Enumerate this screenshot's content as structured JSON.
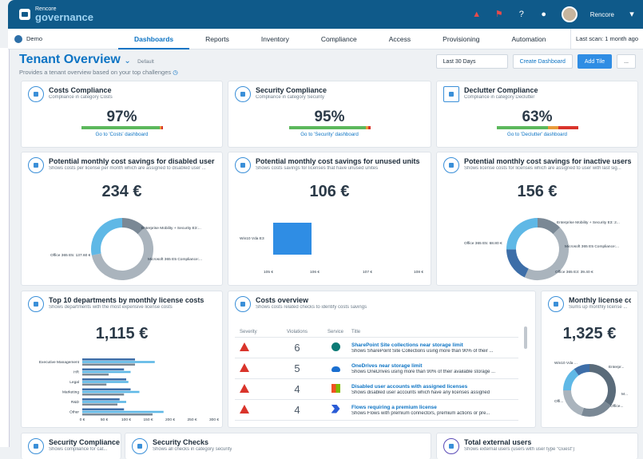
{
  "header": {
    "brand_small": "Rencore",
    "brand_big": "governance",
    "user": "Rencore"
  },
  "nav": {
    "tenant": "Demo",
    "tabs": [
      "Dashboards",
      "Reports",
      "Inventory",
      "Compliance",
      "Access",
      "Provisioning",
      "Automation"
    ],
    "last_scan": "Last scan: 1 month ago"
  },
  "page": {
    "title": "Tenant Overview",
    "default_tag": "Default",
    "subtitle": "Provides a tenant overview based on your top challenges",
    "range": "Last 30 Days",
    "create": "Create Dashboard",
    "add": "Add Tile",
    "more": "..."
  },
  "cards": {
    "costs": {
      "title": "Costs Compliance",
      "sub": "Compliance in category Costs",
      "value": "97%",
      "link": "Go to 'Costs' dashboard"
    },
    "security": {
      "title": "Security Compliance",
      "sub": "Compliance in category Security",
      "value": "95%",
      "link": "Go to 'Security' dashboard"
    },
    "declutter": {
      "title": "Declutter Compliance",
      "sub": "Compliance in category Declutter",
      "value": "63%",
      "link": "Go to 'Declutter' dashboard"
    },
    "disabled": {
      "title": "Potential monthly cost savings for disabled user acc...",
      "sub": "Shows costs per license per month which are assigned to disabled user ...",
      "value": "234 €",
      "labels": [
        "Enterprise Mobility + Security E3:...",
        "Office 365 E5: 137.60 €",
        "Microsoft 365 E5 Compliance:..."
      ]
    },
    "unused": {
      "title": "Potential monthly cost savings for unused units",
      "sub": "Shows costs savings for licenses that have unused unites",
      "value": "106 €",
      "bar_label": "Win10 Vda E3",
      "ticks": [
        "105 €",
        "106 €",
        "107 €",
        "108 €"
      ]
    },
    "inactive": {
      "title": "Potential monthly cost savings for inactive users",
      "sub": "Shows license costs for licenses which are assigned to user with last sig...",
      "value": "156 €",
      "labels": [
        "Enterprise Mobility + Security E3: 2...",
        "Office 365 E5: 68.80 €",
        "Microsoft 365 E5 Compliance:...",
        "Office 365 E3: 39.40 €"
      ]
    },
    "departments": {
      "title": "Top 10 departments by monthly license costs",
      "sub": "Shows departments with the most expensive license costs",
      "value": "1,115 €",
      "cats": [
        "Executive Management",
        "HR",
        "Legal",
        "Marketing",
        "R&D",
        "Other"
      ],
      "ticks": [
        "0 €",
        "50 €",
        "100 €",
        "150 €",
        "200 €",
        "250 €",
        "300 €"
      ]
    },
    "overview": {
      "title": "Costs overview",
      "sub": "Shows costs related checks to identify costs savings",
      "cols": [
        "Severity",
        "Violations",
        "Service",
        "Title"
      ],
      "rows": [
        {
          "violations": "6",
          "title": "SharePoint Site collections near storage limit",
          "desc": "Shows SharePoint Site Collections using more than 90% of their ..."
        },
        {
          "violations": "5",
          "title": "OneDrives near storage limit",
          "desc": "Shows OneDrives using more than 90% of their available storage ..."
        },
        {
          "violations": "4",
          "title": "Disabled user accounts with assigned licenses",
          "desc": "Shows disabled user accounts which have any licenses assigned"
        },
        {
          "violations": "4",
          "title": "Flows requiring a premium license",
          "desc": "Shows Flows with premium connectors, premium actions or pre..."
        }
      ]
    },
    "monthly": {
      "title": "Monthly license co...",
      "sub": "Sums up monthly license ...",
      "value": "1,325 €",
      "labels": [
        "Win10 Vda ...",
        "Enterpr...",
        "M...",
        "Offi...",
        "Office..."
      ]
    },
    "sec2": {
      "title": "Security Compliance",
      "sub": "Shows compliance for cat..."
    },
    "checks": {
      "title": "Security Checks",
      "sub": "Shows all checks in category security"
    },
    "external": {
      "title": "Total external users",
      "sub": "Shows external users (users with user type \"Guest\")"
    }
  },
  "chart_data": [
    {
      "type": "pie",
      "title": "Potential monthly cost savings for disabled user acc...",
      "labels": [
        "Enterprise Mobility + Security E3",
        "Office 365 E5",
        "Microsoft 365 E5 Compliance"
      ],
      "values": [
        30,
        137.6,
        66
      ]
    },
    {
      "type": "bar",
      "title": "Potential monthly cost savings for unused units",
      "categories": [
        "Win10 Vda E3"
      ],
      "values": [
        106
      ],
      "xlim": [
        105,
        108
      ]
    },
    {
      "type": "pie",
      "title": "Potential monthly cost savings for inactive users",
      "labels": [
        "Enterprise Mobility + Security E3",
        "Office 365 E5",
        "Microsoft 365 E5 Compliance",
        "Office 365 E3"
      ],
      "values": [
        20,
        68.8,
        28,
        39.4
      ]
    },
    {
      "type": "bar",
      "title": "Top 10 departments by monthly license costs",
      "categories": [
        "Executive Management",
        "HR",
        "Legal",
        "Marketing",
        "R&D",
        "Other"
      ],
      "series": [
        {
          "values": [
            120,
            95,
            100,
            110,
            85,
            95
          ]
        },
        {
          "values": [
            165,
            110,
            105,
            130,
            100,
            185
          ]
        },
        {
          "values": [
            120,
            60,
            55,
            95,
            80,
            160
          ]
        }
      ],
      "xlim": [
        0,
        300
      ]
    }
  ],
  "colors": {
    "brand": "#0f5a8a",
    "accent": "#0d74c4",
    "critical": "#d9342b"
  }
}
